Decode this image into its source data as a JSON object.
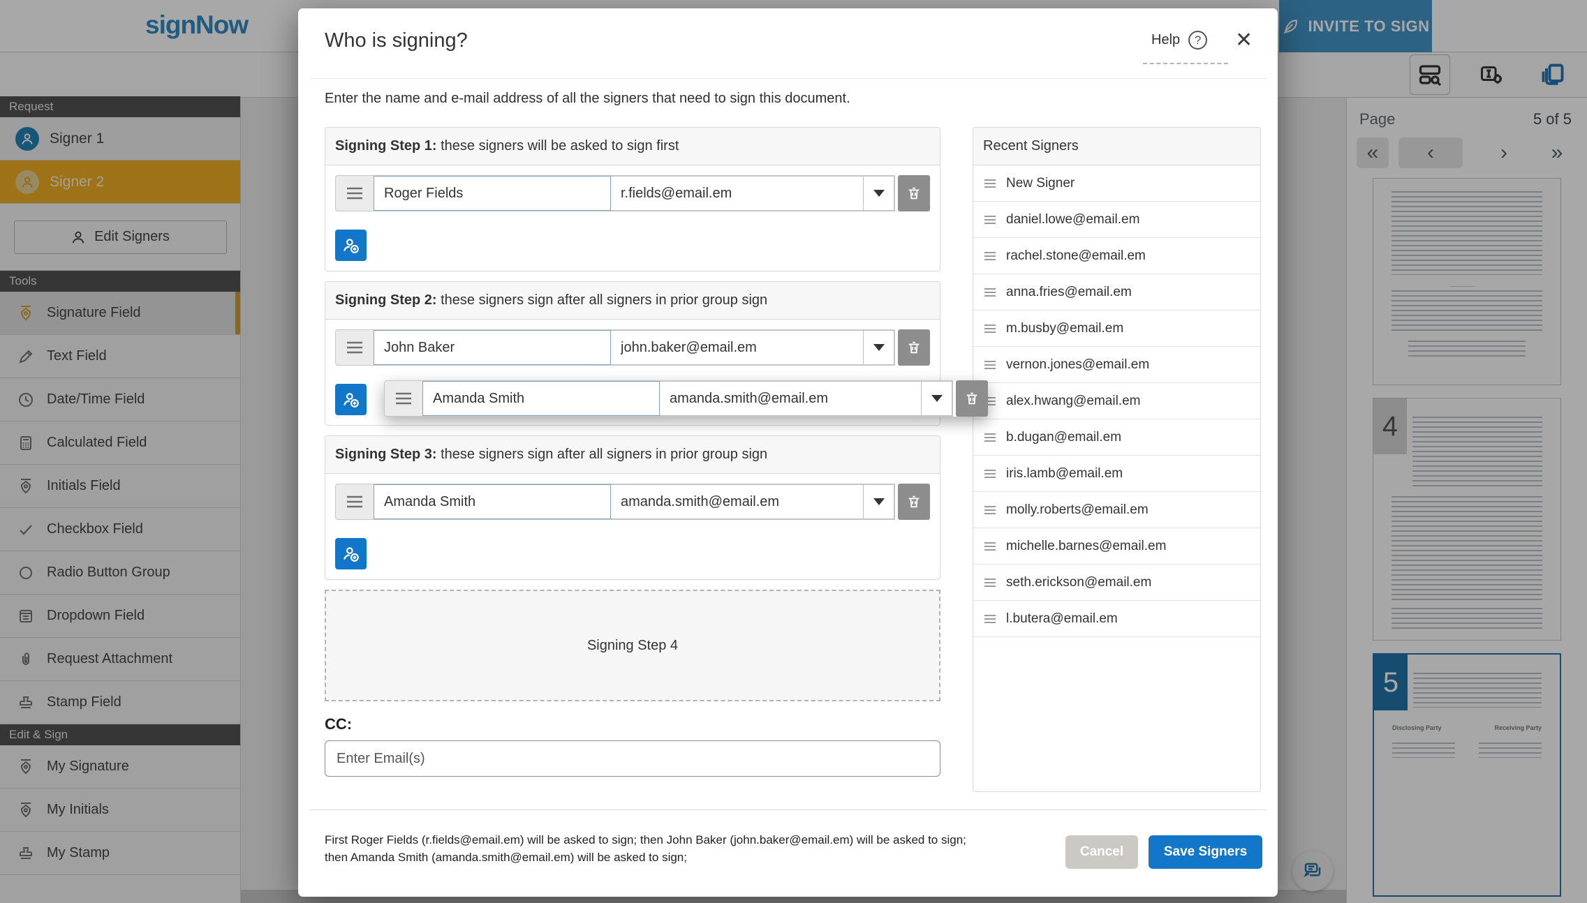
{
  "header": {
    "logo": "signNow",
    "invite_button": "INVITE TO SIGN"
  },
  "sidebar": {
    "request": {
      "label": "Request",
      "signer1": "Signer 1",
      "signer2": "Signer 2",
      "edit_button": "Edit Signers"
    },
    "tools": {
      "label": "Tools",
      "items": [
        {
          "label": "Signature Field"
        },
        {
          "label": "Text Field"
        },
        {
          "label": "Date/Time Field"
        },
        {
          "label": "Calculated Field"
        },
        {
          "label": "Initials Field"
        },
        {
          "label": "Checkbox Field"
        },
        {
          "label": "Radio Button Group"
        },
        {
          "label": "Dropdown Field"
        },
        {
          "label": "Request Attachment"
        },
        {
          "label": "Stamp Field"
        }
      ]
    },
    "edit_sign": {
      "label": "Edit & Sign",
      "items": [
        {
          "label": "My Signature"
        },
        {
          "label": "My Initials"
        },
        {
          "label": "My Stamp"
        }
      ]
    }
  },
  "modal": {
    "title": "Who is signing?",
    "help_label": "Help",
    "help_icon": "?",
    "close_icon": "✕",
    "instruction": "Enter the name and e-mail address of all the signers that need to sign this document.",
    "steps": [
      {
        "title_bold": "Signing Step 1:",
        "title_rest": " these signers will be asked to sign first",
        "signers": [
          {
            "name": "Roger Fields",
            "email": "r.fields@email.em"
          }
        ]
      },
      {
        "title_bold": "Signing Step 2:",
        "title_rest": " these signers sign after all signers in prior group sign",
        "signers": [
          {
            "name": "John Baker",
            "email": "john.baker@email.em"
          }
        ]
      },
      {
        "title_bold": "Signing Step 3:",
        "title_rest": " these signers sign after all signers in prior group sign",
        "signers": [
          {
            "name": "Amanda Smith",
            "email": "amanda.smith@email.em"
          }
        ]
      }
    ],
    "dragged_signer": {
      "name": "Amanda Smith",
      "email": "amanda.smith@email.em"
    },
    "step4_label": "Signing Step 4",
    "cc": {
      "label": "CC:",
      "placeholder": "Enter Email(s)"
    },
    "footer": {
      "summary_line1": "First Roger Fields (r.fields@email.em) will be asked to sign; then John Baker (john.baker@email.em) will be asked to sign;",
      "summary_line2": "then Amanda Smith (amanda.smith@email.em) will be asked to sign;",
      "cancel_button": "Cancel",
      "save_button": "Save Signers"
    }
  },
  "recent_signers": {
    "title": "Recent Signers",
    "items": [
      "New Signer",
      "daniel.lowe@email.em",
      "rachel.stone@email.em",
      "anna.fries@email.em",
      "m.busby@email.em",
      "vernon.jones@email.em",
      "alex.hwang@email.em",
      "b.dugan@email.em",
      "iris.lamb@email.em",
      "molly.roberts@email.em",
      "michelle.barnes@email.em",
      "seth.erickson@email.em",
      "l.butera@email.em"
    ]
  },
  "page_panel": {
    "label": "Page",
    "count": "5 of 5",
    "nav": {
      "first": "«",
      "prev": "‹",
      "next": "›",
      "last": "»"
    },
    "thumbnails": [
      {
        "badge": "4"
      },
      {
        "badge": "5"
      }
    ]
  },
  "colors": {
    "accent_blue": "#1377C9",
    "brand_blue": "#2D87C0",
    "signer2_gold": "#EFAC1F",
    "selected_thumb_border": "#1A6FA8"
  }
}
